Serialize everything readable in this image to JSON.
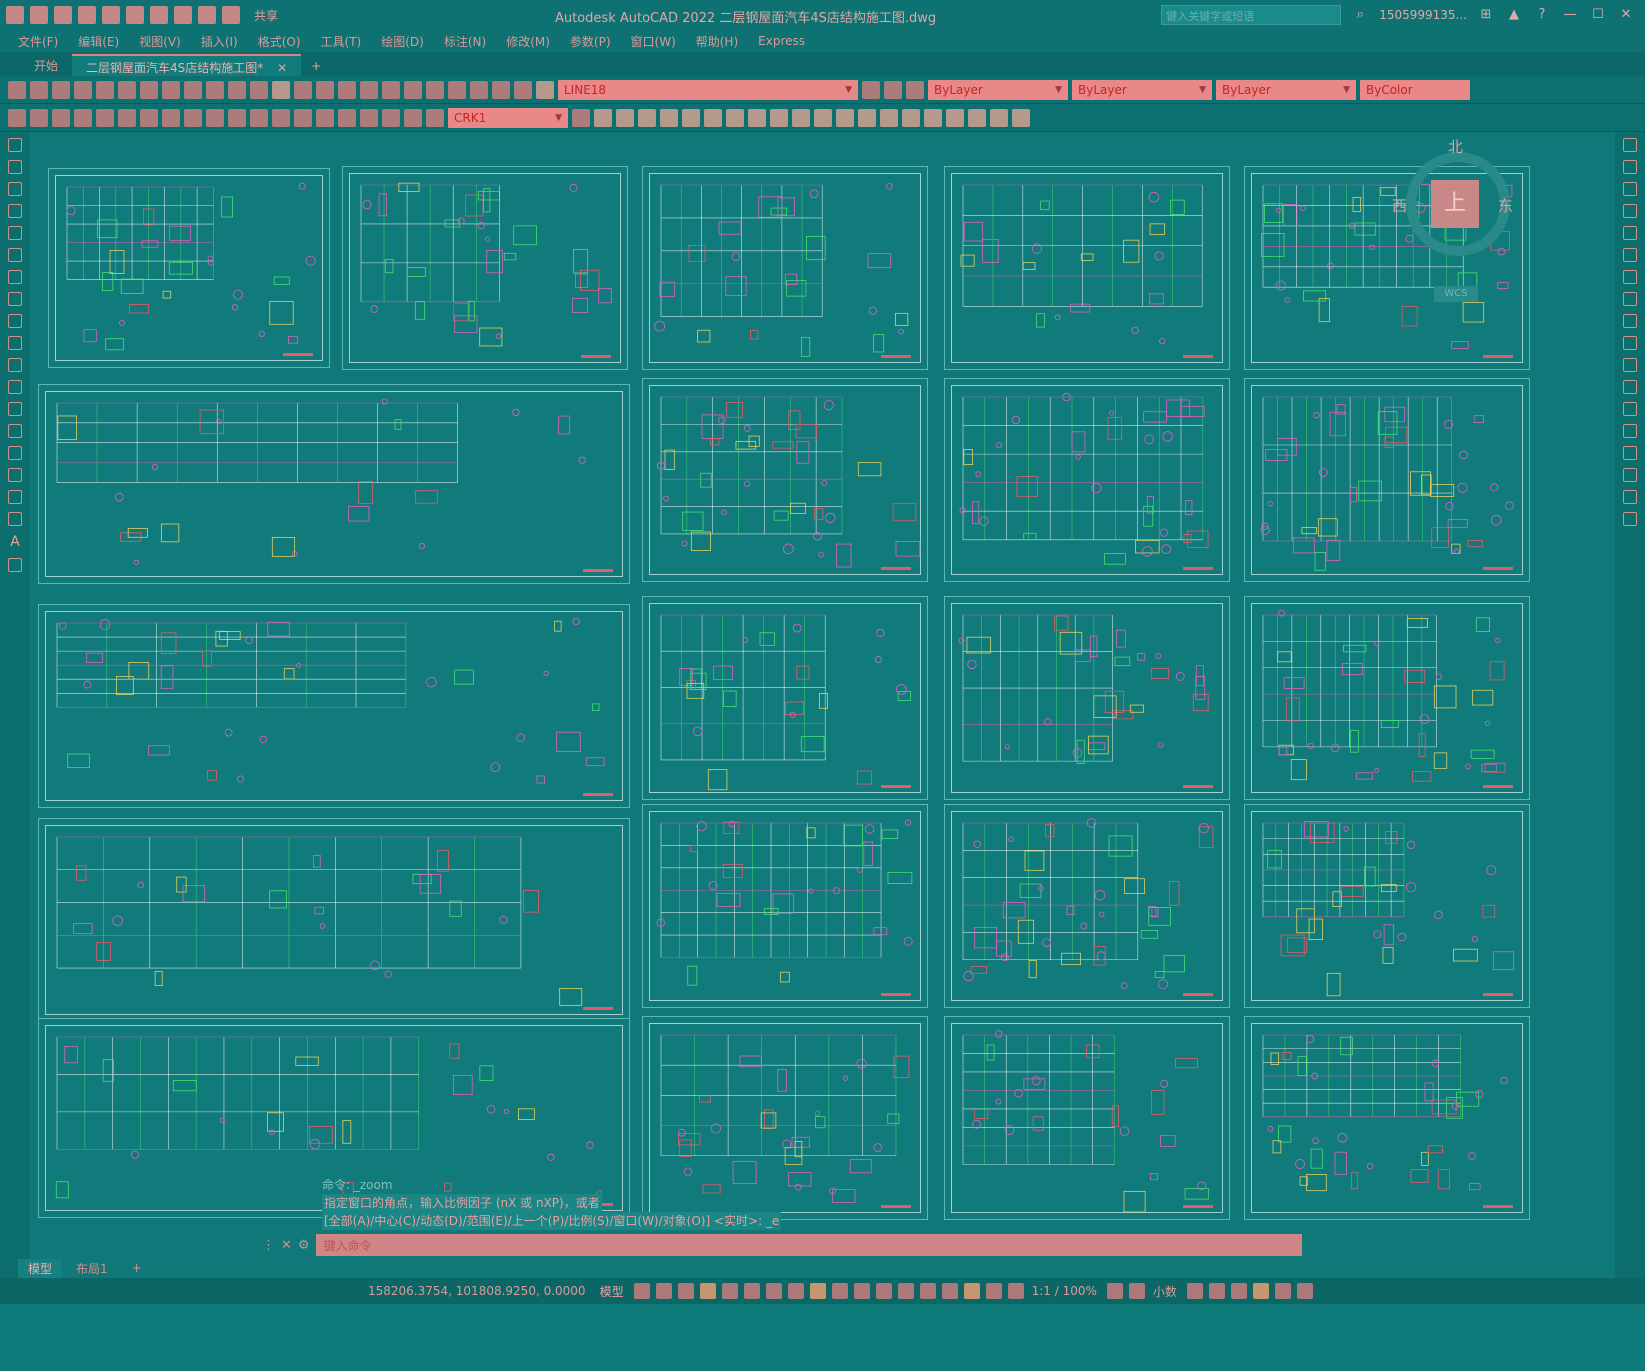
{
  "app": {
    "title": "Autodesk AutoCAD 2022    二层钢屋面汽车4S店结构施工图.dwg",
    "share_label": "共享",
    "search_placeholder": "键入关键字或短语",
    "user": "1505999135...",
    "minimize": "—",
    "restore": "☐",
    "close": "✕"
  },
  "menu": [
    "文件(F)",
    "编辑(E)",
    "视图(V)",
    "插入(I)",
    "格式(O)",
    "工具(T)",
    "绘图(D)",
    "标注(N)",
    "修改(M)",
    "参数(P)",
    "窗口(W)",
    "帮助(H)",
    "Express"
  ],
  "tabs": {
    "start": "开始",
    "active": "二层钢屋面汽车4S店结构施工图*",
    "close": "✕",
    "add": "+"
  },
  "toolbar": {
    "layer": "LINE18",
    "color": "ByLayer",
    "linetype": "ByLayer",
    "lineweight": "ByLayer",
    "plotstyle": "ByColor",
    "style": "CRK1"
  },
  "viewcube": {
    "north": "北",
    "west": "西",
    "east": "东",
    "top": "上",
    "wcs": "WCS"
  },
  "command": {
    "history_1": "命令: _zoom",
    "history_2": "指定窗口的角点，输入比例因子 (nX 或 nXP)，或者",
    "history_3": "[全部(A)/中心(C)/动态(D)/范围(E)/上一个(P)/比例(S)/窗口(W)/对象(O)] <实时>: _e",
    "placeholder": "键入命令"
  },
  "layouts": [
    "模型",
    "布局1",
    "+"
  ],
  "status": {
    "coords": "158206.3754, 101808.9250, 0.0000",
    "model": "模型",
    "scale": "1:1 / 100%",
    "units": "小数"
  },
  "colors": {
    "background": "#0f7a7a",
    "accent": "#e88888",
    "sheet_border": "#a0d0d0",
    "line_magenta": "#e060c0",
    "line_green": "#40e070",
    "line_yellow": "#e0d060",
    "line_red": "#e85a6a"
  }
}
